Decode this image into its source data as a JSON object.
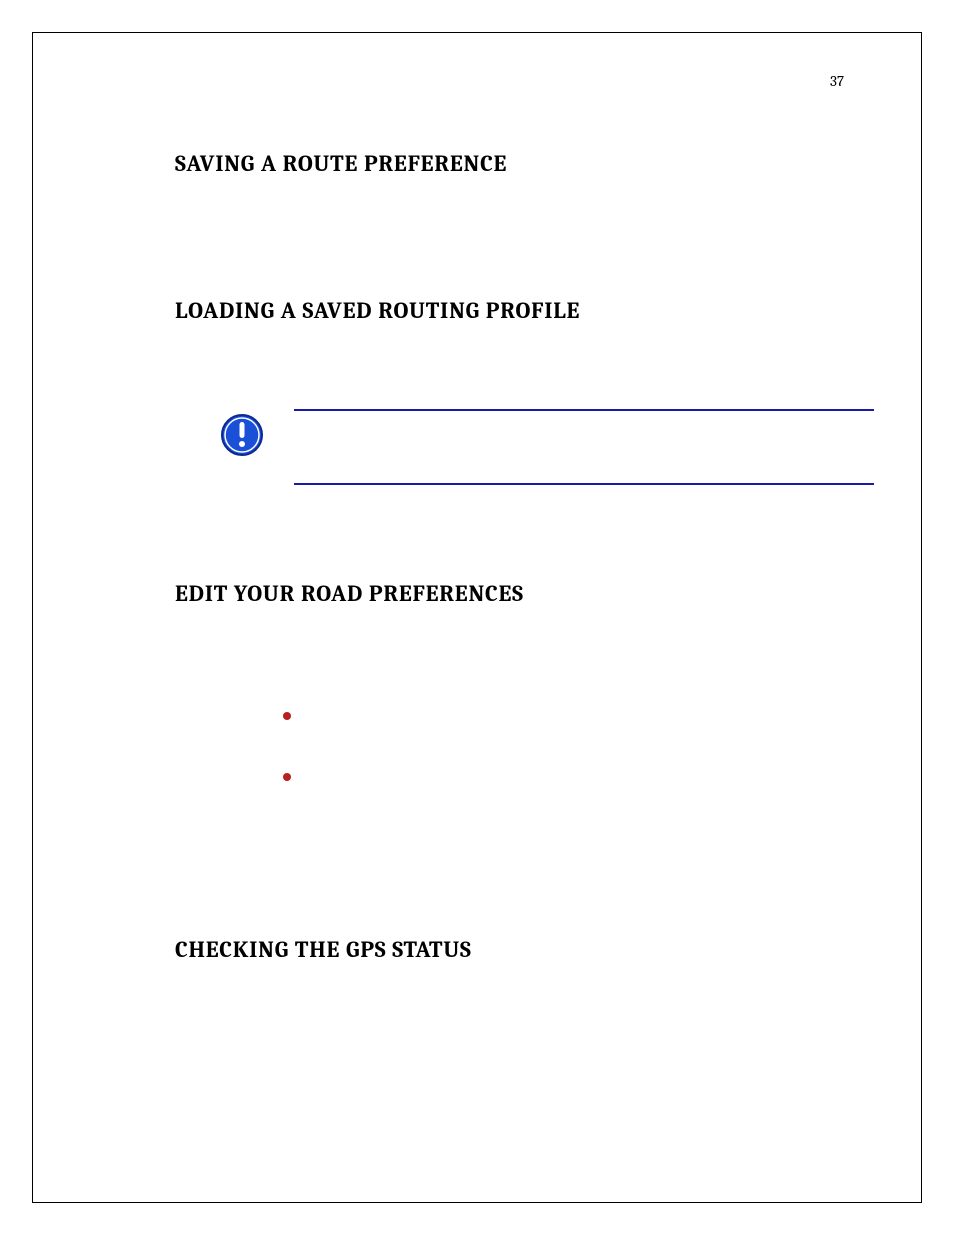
{
  "page_number": "37",
  "headings": {
    "saving": "SAVING A ROUTE PREFERENCE",
    "loading": "LOADING A SAVED ROUTING PROFILE",
    "edit": "EDIT YOUR ROAD PREFERENCES",
    "gps": "CHECKING THE GPS STATUS"
  },
  "icons": {
    "info": "info-icon"
  }
}
